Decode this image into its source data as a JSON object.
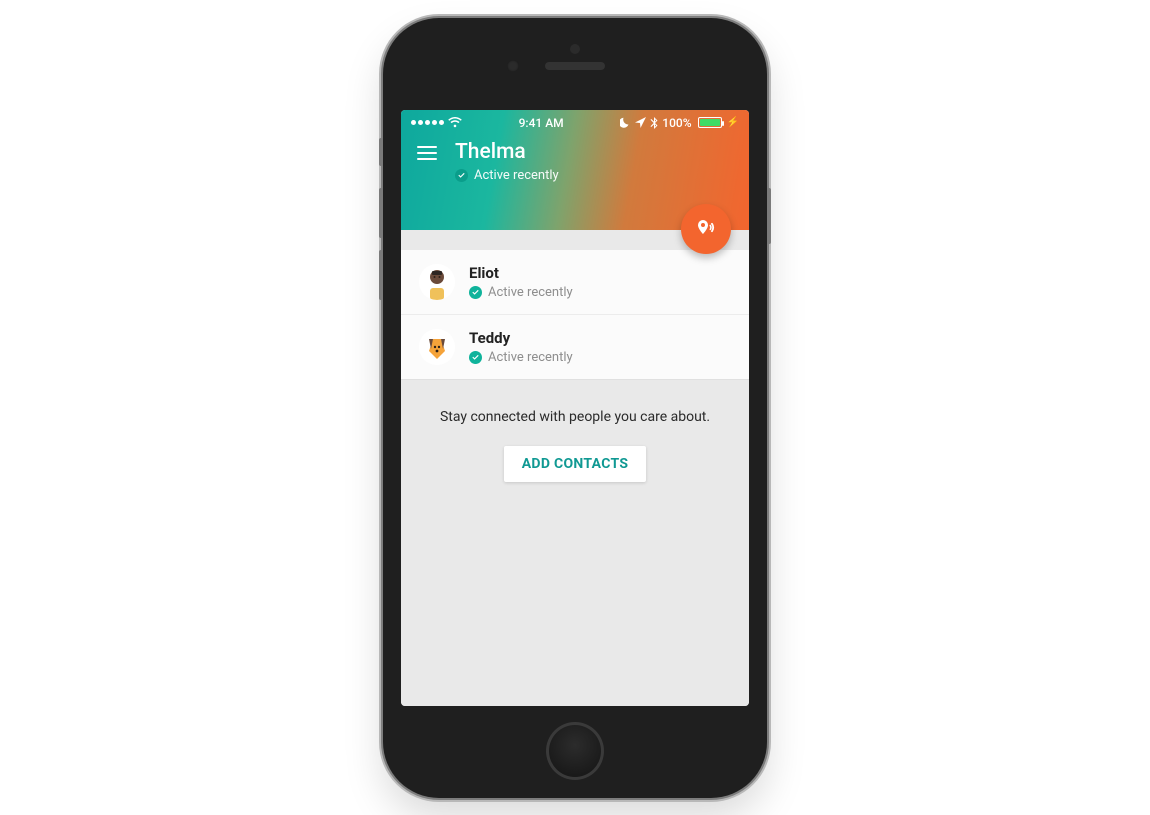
{
  "status_bar": {
    "time": "9:41 AM",
    "battery_percent": "100%"
  },
  "header": {
    "title": "Thelma",
    "status": "Active recently"
  },
  "contacts": [
    {
      "name": "Eliot",
      "status": "Active recently"
    },
    {
      "name": "Teddy",
      "status": "Active recently"
    }
  ],
  "promo": {
    "text": "Stay connected with people you care about.",
    "button_label": "ADD CONTACTS"
  },
  "colors": {
    "accent_teal": "#0fb39b",
    "fab_orange": "#f3652e"
  }
}
